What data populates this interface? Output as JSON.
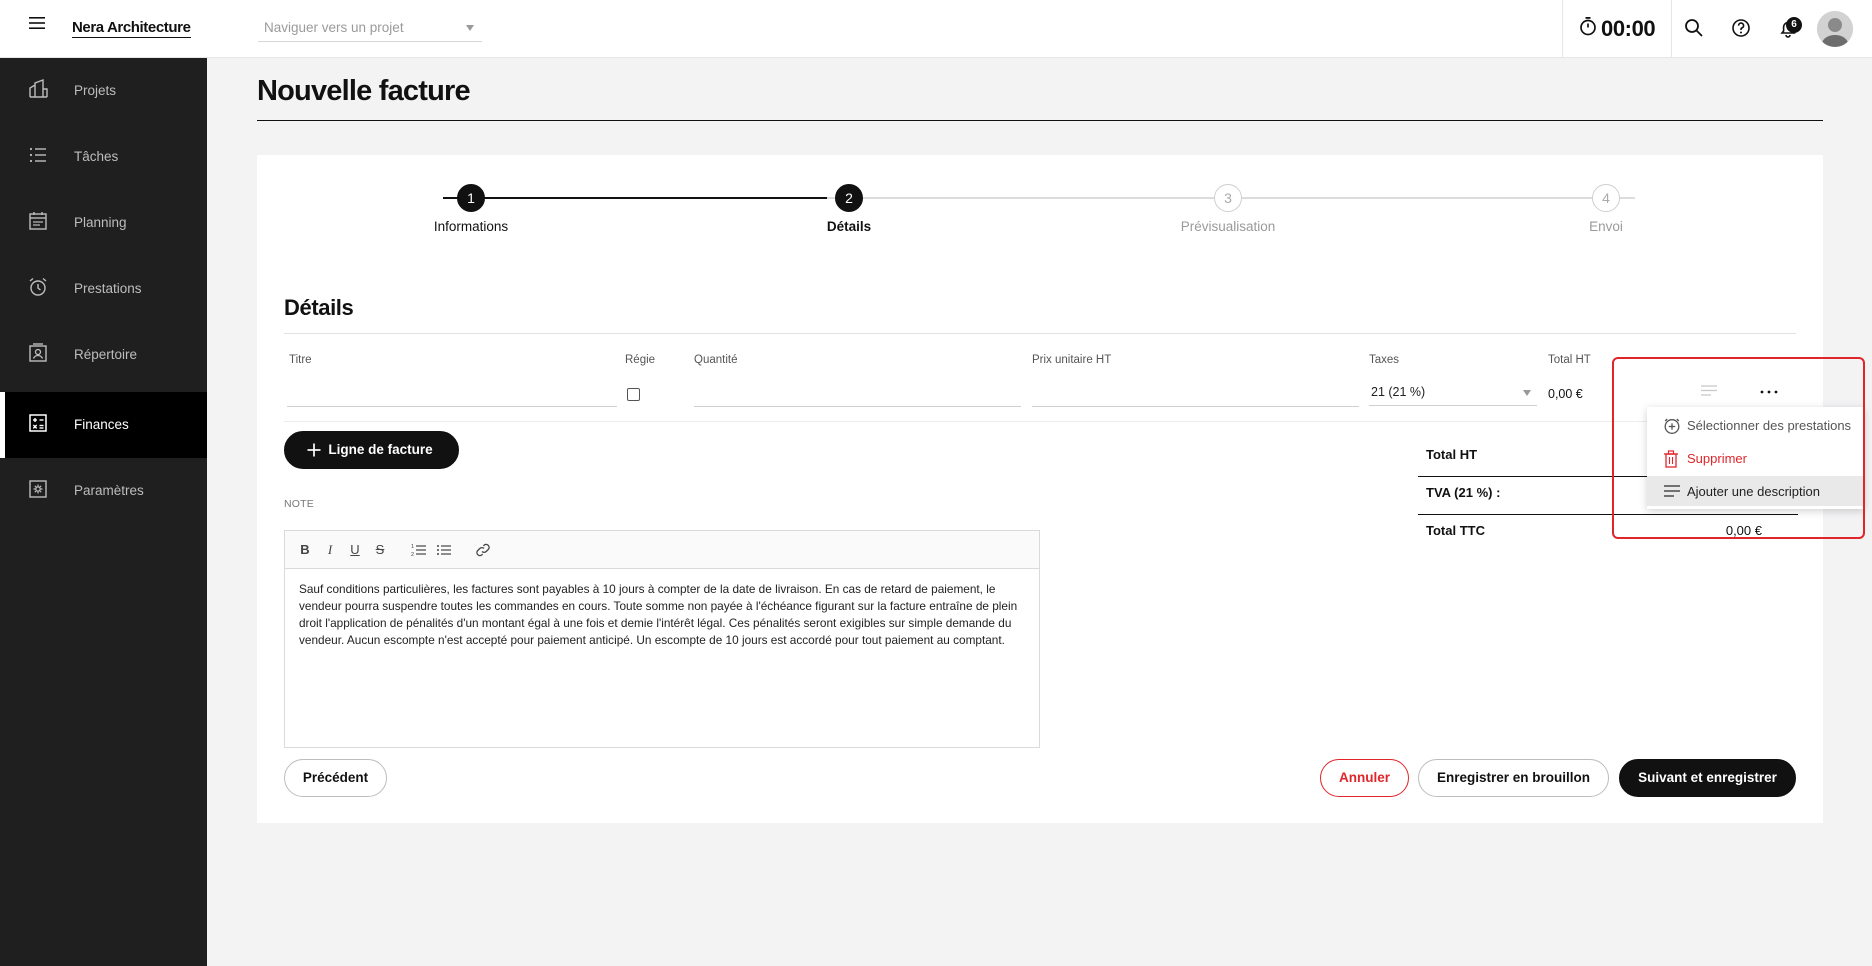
{
  "header": {
    "brand": "Nera Architecture",
    "project_placeholder": "Naviguer vers un projet",
    "timer": "00:00",
    "notification_count": "6"
  },
  "sidebar": {
    "items": [
      {
        "label": "Projets",
        "icon": "buildings-icon"
      },
      {
        "label": "Tâches",
        "icon": "list-icon"
      },
      {
        "label": "Planning",
        "icon": "calendar-icon"
      },
      {
        "label": "Prestations",
        "icon": "alarm-clock-icon"
      },
      {
        "label": "Répertoire",
        "icon": "contact-card-icon"
      },
      {
        "label": "Finances",
        "icon": "calculator-icon",
        "active": true
      },
      {
        "label": "Paramètres",
        "icon": "gear-box-icon"
      }
    ]
  },
  "page": {
    "title": "Nouvelle facture"
  },
  "stepper": {
    "steps": [
      {
        "number": "1",
        "label": "Informations",
        "state": "done"
      },
      {
        "number": "2",
        "label": "Détails",
        "state": "current"
      },
      {
        "number": "3",
        "label": "Prévisualisation",
        "state": "todo"
      },
      {
        "number": "4",
        "label": "Envoi",
        "state": "todo"
      }
    ]
  },
  "details": {
    "title": "Détails",
    "columns": {
      "titre": "Titre",
      "regie": "Régie",
      "quantite": "Quantité",
      "prix": "Prix unitaire HT",
      "taxes": "Taxes",
      "total": "Total HT"
    },
    "line": {
      "titre": "",
      "quantite": "",
      "prix": "",
      "tax": "21 (21 %)",
      "total": "0,00 €"
    },
    "add_line_label": "Ligne de facture"
  },
  "note": {
    "label": "NOTE",
    "text": "Sauf conditions particulières, les factures sont payables à 10 jours à compter de la date de livraison. En cas de retard de paiement, le vendeur pourra suspendre toutes les commandes en cours. Toute somme non payée à l'échéance figurant sur la facture entraîne de plein droit l'application de pénalités d'un montant égal à une fois et demie l'intérêt légal. Ces pénalités seront exigibles sur simple demande du vendeur. Aucun escompte n'est accepté pour paiement anticipé. Un escompte de 10 jours est accordé pour tout paiement au comptant."
  },
  "totals": {
    "ht_label": "Total HT",
    "ht_value": "",
    "tva_label": "TVA (21 %) :",
    "tva_value": "",
    "ttc_label": "Total TTC",
    "ttc_value": "0,00 €"
  },
  "menu": {
    "items": [
      {
        "label": "Sélectionner des prestations",
        "icon": "add-circle-clock-icon"
      },
      {
        "label": "Supprimer",
        "icon": "trash-icon"
      },
      {
        "label": "Ajouter une description",
        "icon": "text-lines-icon"
      }
    ]
  },
  "footer": {
    "previous": "Précédent",
    "cancel": "Annuler",
    "draft": "Enregistrer en brouillon",
    "next": "Suivant et enregistrer"
  },
  "colors": {
    "accent": "#111111",
    "danger": "#e0262b",
    "sidebar_bg": "#1f1f20"
  }
}
